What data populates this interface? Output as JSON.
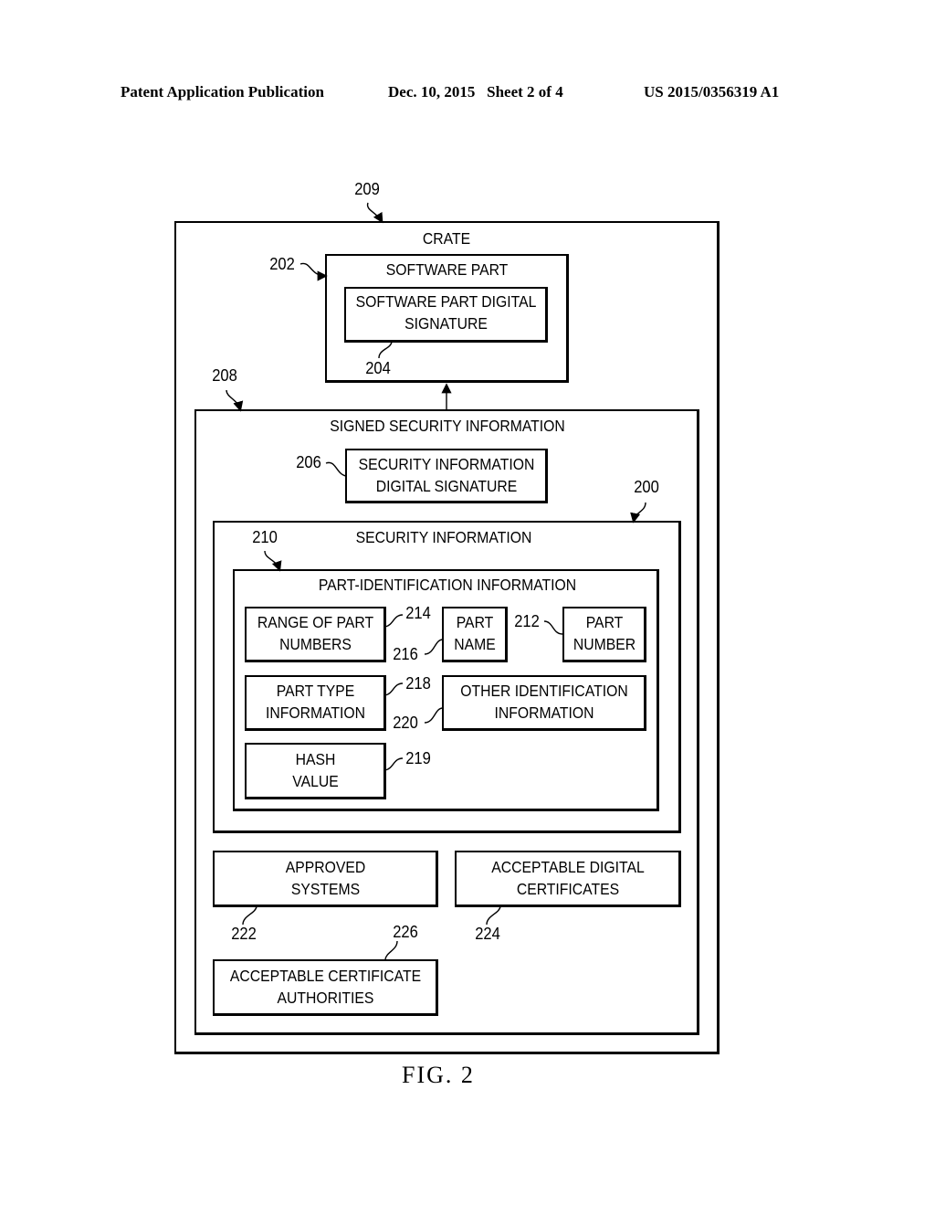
{
  "header": {
    "publication": "Patent Application Publication",
    "date_sheet": "Dec. 10, 2015   Sheet 2 of 4",
    "patent_number": "US 2015/0356319 A1"
  },
  "figure": {
    "caption": "FIG. 2",
    "crate": {
      "ref": "209",
      "title": "CRATE"
    },
    "software_part": {
      "ref": "202",
      "title": "SOFTWARE PART",
      "signature": {
        "ref": "204",
        "line1": "SOFTWARE PART DIGITAL",
        "line2": "SIGNATURE"
      }
    },
    "signed_security_information": {
      "ref": "208",
      "title": "SIGNED SECURITY INFORMATION",
      "signature": {
        "ref": "206",
        "line1": "SECURITY INFORMATION",
        "line2": "DIGITAL SIGNATURE"
      }
    },
    "security_information": {
      "ref": "200",
      "title": "SECURITY INFORMATION"
    },
    "part_identification": {
      "ref": "210",
      "title": "PART-IDENTIFICATION INFORMATION",
      "items": [
        {
          "ref": "214",
          "line1": "RANGE OF PART",
          "line2": "NUMBERS"
        },
        {
          "ref": "216",
          "line1": "PART",
          "line2": "NAME"
        },
        {
          "ref": "212",
          "line1": "PART",
          "line2": "NUMBER"
        },
        {
          "ref": "218",
          "line1": "PART TYPE",
          "line2": "INFORMATION"
        },
        {
          "ref": "220",
          "line1": "OTHER IDENTIFICATION",
          "line2": "INFORMATION"
        },
        {
          "ref": "219",
          "line1": "HASH",
          "line2": "VALUE"
        }
      ]
    },
    "approved_systems": {
      "ref": "222",
      "line1": "APPROVED",
      "line2": "SYSTEMS"
    },
    "acceptable_certificates": {
      "ref": "224",
      "line1": "ACCEPTABLE DIGITAL",
      "line2": "CERTIFICATES"
    },
    "acceptable_authorities": {
      "ref": "226",
      "line1": "ACCEPTABLE CERTIFICATE",
      "line2": "AUTHORITIES"
    }
  }
}
